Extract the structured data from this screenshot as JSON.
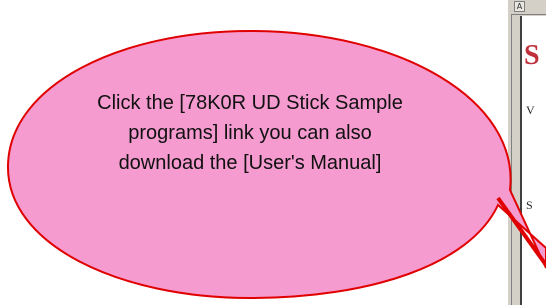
{
  "callout": {
    "line1": "Click the [78K0R UD Stick Sample",
    "line2": "programs] link you can also",
    "line3": "download the [User's Manual]",
    "fill_color": "#f59bd0",
    "border_color": "#e00000"
  },
  "browser": {
    "heading_fragment": "S",
    "text_fragment_1": "V",
    "text_fragment_2": "S",
    "heading_color": "#c0303a",
    "toolbar_button_icon": "page-icon"
  }
}
